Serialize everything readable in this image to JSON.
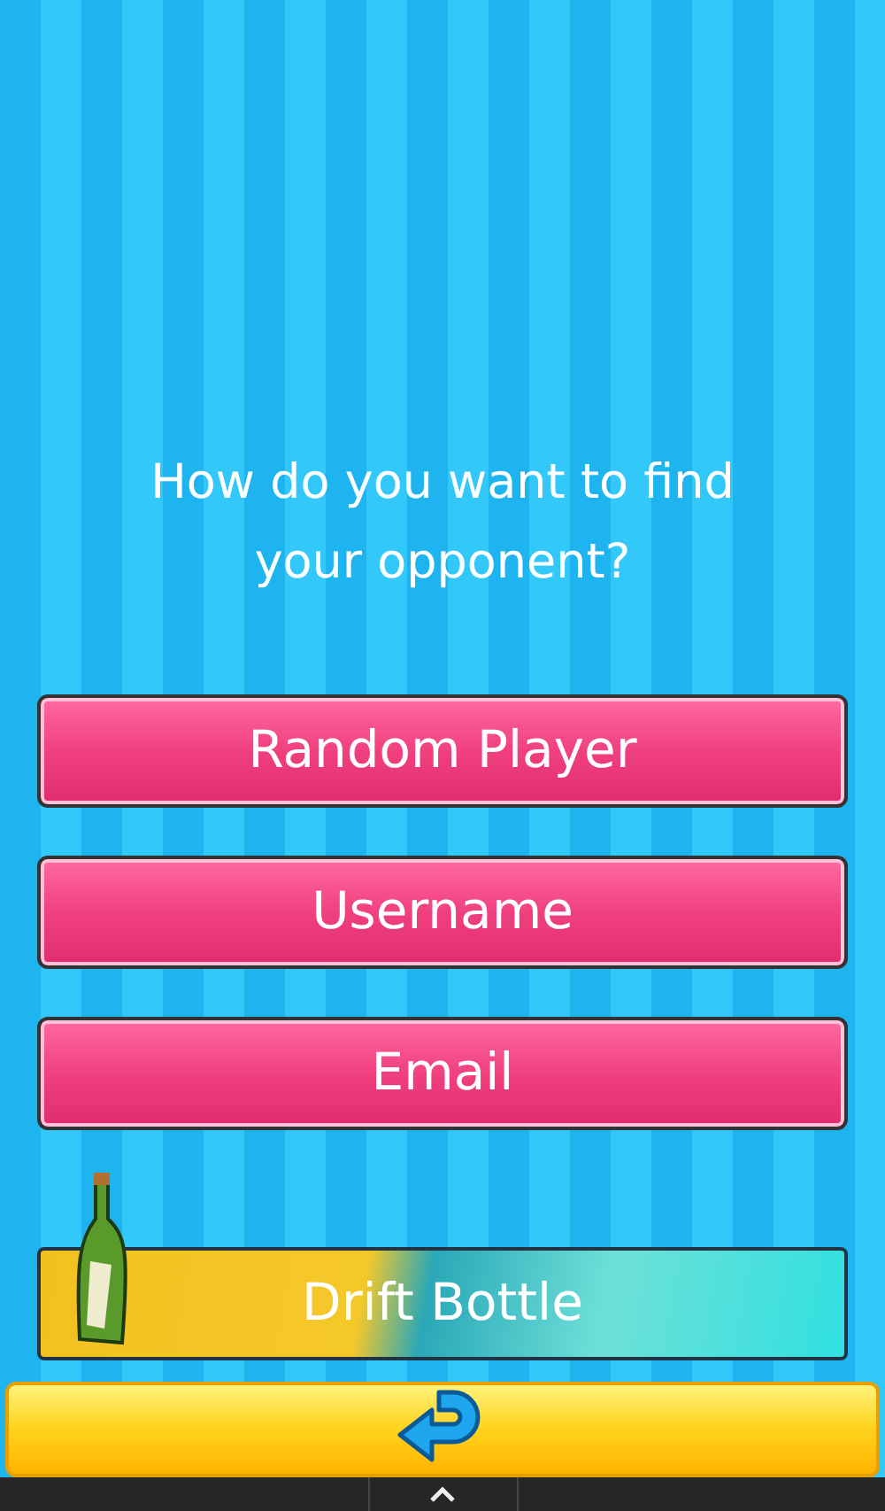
{
  "prompt": "How do you want to find your opponent?",
  "options": [
    {
      "label": "Random Player",
      "kind": "pink"
    },
    {
      "label": "Username",
      "kind": "pink"
    },
    {
      "label": "Email",
      "kind": "pink"
    },
    {
      "label": "Drift Bottle",
      "kind": "bottle"
    }
  ]
}
